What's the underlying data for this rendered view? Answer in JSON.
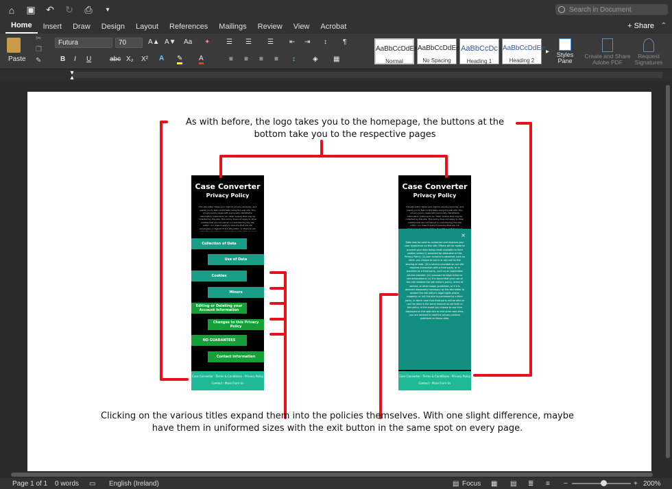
{
  "titlebar": {
    "search_placeholder": "Search in Document"
  },
  "menu": {
    "tabs": [
      "Home",
      "Insert",
      "Draw",
      "Design",
      "Layout",
      "References",
      "Mailings",
      "Review",
      "View",
      "Acrobat"
    ],
    "active_tab": "Home",
    "share_label": "Share"
  },
  "ribbon": {
    "paste_label": "Paste",
    "font_name": "Futura",
    "font_size": "70",
    "styles": [
      {
        "sample": "AaBbCcDdEe",
        "label": "Normal"
      },
      {
        "sample": "AaBbCcDdEe",
        "label": "No Spacing"
      },
      {
        "sample": "AaBbCcDc",
        "label": "Heading 1"
      },
      {
        "sample": "AaBbCcDdEe",
        "label": "Heading 2"
      }
    ],
    "styles_pane_label": "Styles Pane",
    "create_pdf_label": "Create and Share Adobe PDF",
    "request_signatures_label": "Request Signatures"
  },
  "document": {
    "top_note": "As with before, the logo takes you to the homepage, the buttons at the bottom take you to the respective pages",
    "bottom_note": "Clicking on the various titles expand them into the policies themselves. With one slight difference, maybe have them in uniformed sizes with the exit button in the same spot on every page.",
    "mockup_left": {
      "title": "Case Converter",
      "subtitle": "Privacy Policy",
      "intro": "The site editor takes your right to privacy seriously, and wants you to feel comfortable using the web site. This privacy policy deals with personally-identifiable information (referred to as \"data\" below) that may be collected by this site. This policy does not apply to other entities that are not owned or controlled by the site editor, nor does it apply to persons that are not employees or agents of the site editor, or that are not under the site editor's control. Please take time to read this site's Terms of Use.",
      "buttons": [
        "Collection of Data",
        "Use of Data",
        "Cookies",
        "Minors",
        "Editing or Deleting your Account Information",
        "Changes to this Privacy Policy",
        "NO GUARANTEES",
        "Contact information"
      ],
      "footer_row1": "Case Converter · Terms & Conditions · Privacy Policy",
      "footer_row2": "Contact · More From Us"
    },
    "mockup_right": {
      "title": "Case Converter",
      "subtitle": "Privacy Policy",
      "close_glyph": "×",
      "overlay_text": "Data may be used to customize and improve your user experience on this site. Efforts will be made to prevent your data being made available to third parties unless (i) provided for otherwise in this Privacy Policy; (ii) your consent is obtained, such as when you choose to opt-in or opt-out for the sharing of data; (iii) a service provided on our site requires interaction with a third party, or is provided by a third party, such as an application service provider; (iv) pursuant to legal action or law enforcement; (v) it is found that your use of this site violates the site editor's policy, terms of service, or other usage guidelines, or if it is deemed reasonably necessary by the site editor to protect the site editor's legal rights and/or property; or (vi) this site is purchased by a third party, in which case that third party will be able to use the data in the same manner as set forth in this policy. In the event you choose to use links displayed on this web site to visit other web sites, you are advised to read the privacy policies published on those sites.",
      "footer_row1": "Case Converter · Terms & Conditions · Privacy Policy",
      "footer_row2": "Contact · More From Us"
    }
  },
  "status": {
    "page": "Page 1 of 1",
    "words": "0 words",
    "language": "English (Ireland)",
    "focus": "Focus",
    "zoom": "200%"
  },
  "colors": {
    "annotation_red": "#e8101a",
    "teal": "#1a9e85",
    "green": "#17a03a"
  }
}
